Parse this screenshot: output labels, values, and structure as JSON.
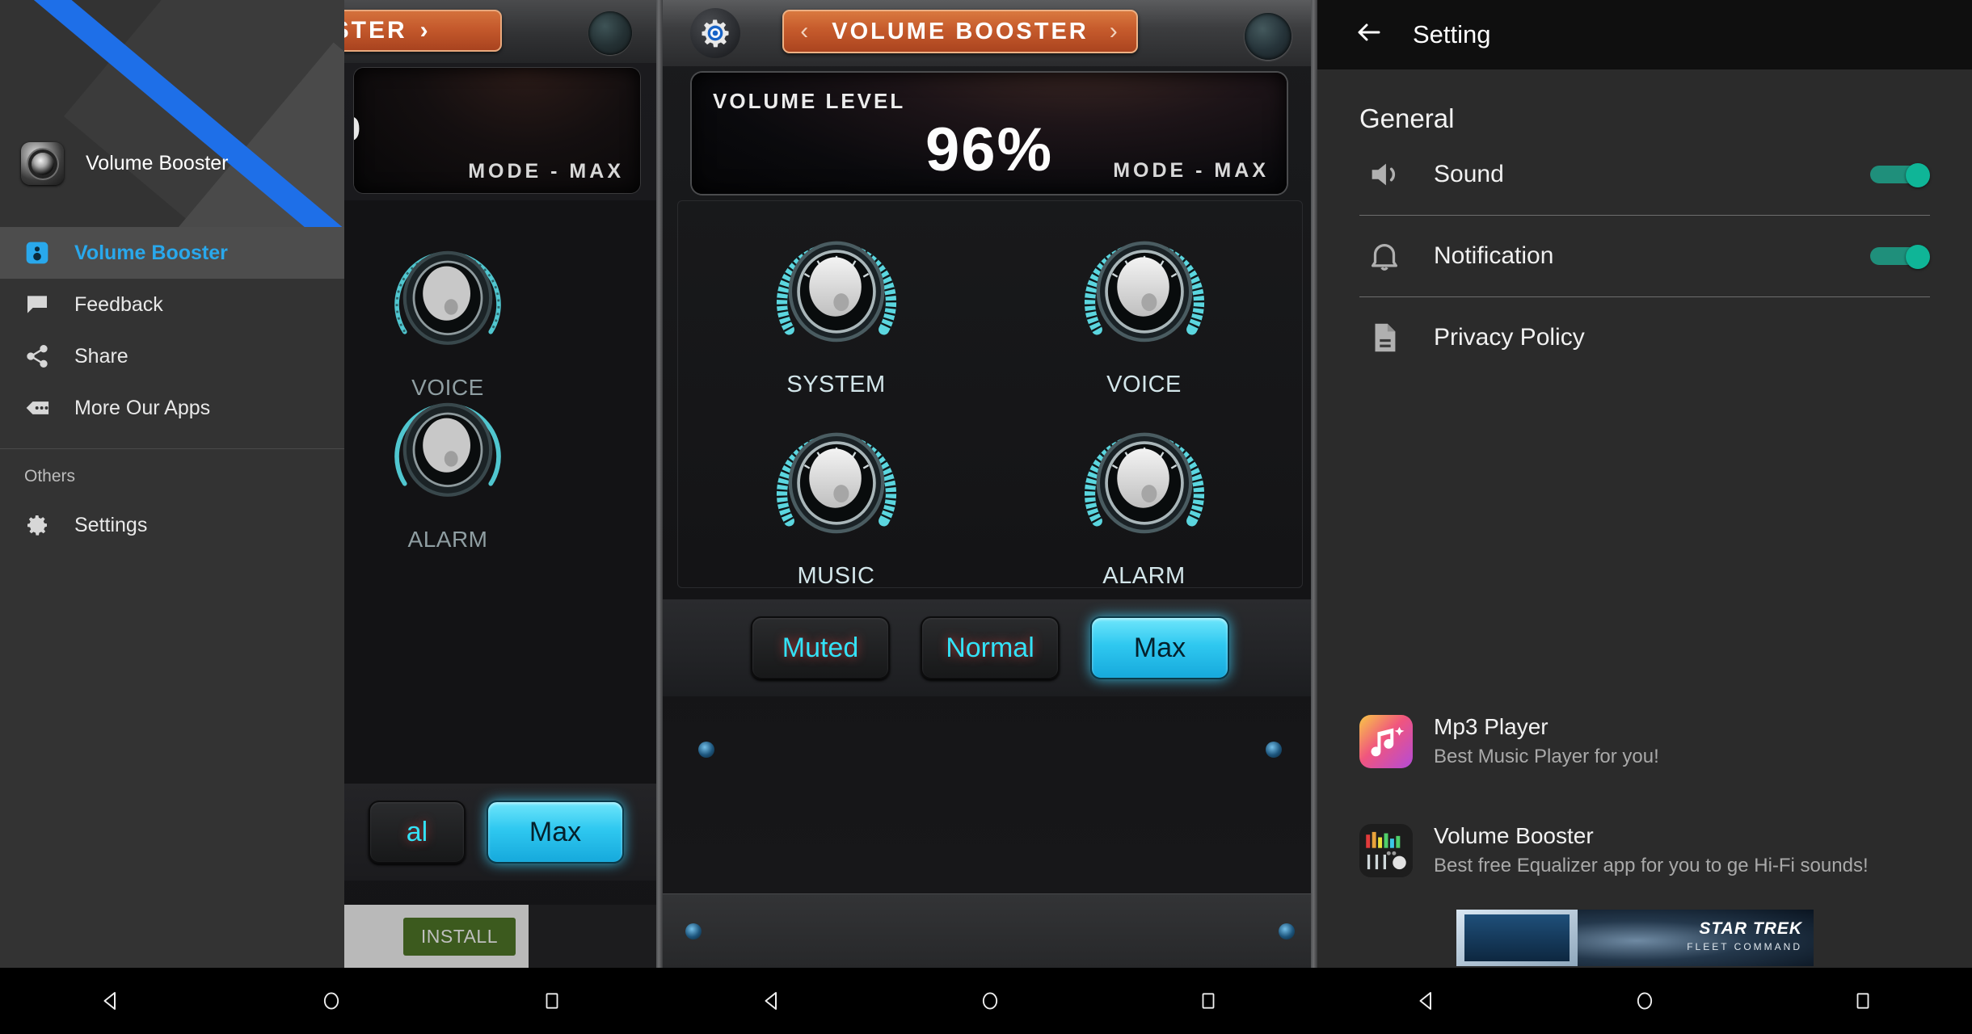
{
  "panel1": {
    "drawer": {
      "app_name": "Volume Booster",
      "items": [
        {
          "label": "Volume Booster",
          "icon": "speaker-icon",
          "active": true
        },
        {
          "label": "Feedback",
          "icon": "chat-icon",
          "active": false
        },
        {
          "label": "Share",
          "icon": "share-icon",
          "active": false
        },
        {
          "label": "More Our Apps",
          "icon": "more-apps-icon",
          "active": false
        }
      ],
      "section_label": "Others",
      "settings_label": "Settings",
      "settings_icon": "gear-icon"
    },
    "app": {
      "title": "BOOSTER",
      "next_arrow": "›",
      "percent": "%",
      "mode": "MODE - MAX",
      "knob_labels": [
        "VOICE",
        "ALARM"
      ],
      "mode_buttons": [
        "al",
        "Max"
      ],
      "install_label": "INSTALL"
    }
  },
  "panel2": {
    "title": "VOLUME BOOSTER",
    "prev_arrow": "‹",
    "next_arrow": "›",
    "gear_icon": "gear-icon",
    "lcd": {
      "label": "VOLUME LEVEL",
      "value": "96%",
      "mode": "MODE - MAX"
    },
    "knobs": [
      {
        "label": "SYSTEM"
      },
      {
        "label": "VOICE"
      },
      {
        "label": "MUSIC"
      },
      {
        "label": "ALARM"
      }
    ],
    "mode_buttons": [
      {
        "label": "Muted",
        "selected": false
      },
      {
        "label": "Normal",
        "selected": false
      },
      {
        "label": "Max",
        "selected": true
      }
    ]
  },
  "panel3": {
    "back_icon": "back-arrow-icon",
    "title": "Setting",
    "section": "General",
    "rows": [
      {
        "label": "Sound",
        "icon": "volume-icon",
        "toggle": true
      },
      {
        "label": "Notification",
        "icon": "bell-icon",
        "toggle": true
      },
      {
        "label": "Privacy Policy",
        "icon": "document-icon",
        "toggle": null
      }
    ],
    "promos": [
      {
        "title": "Mp3 Player",
        "subtitle": "Best Music Player for you!",
        "icon": "mp3-player-icon"
      },
      {
        "title": "Volume Booster",
        "subtitle": "Best free Equalizer app for you to ge Hi-Fi sounds!",
        "icon": "volume-booster-icon"
      }
    ],
    "banner": {
      "title": "STAR TREK",
      "subtitle": "FLEET COMMAND"
    }
  },
  "navbar": {
    "back": "back-triangle-icon",
    "home": "home-circle-icon",
    "recents": "recents-square-icon"
  },
  "colors": {
    "accent_blue": "#29a8ec",
    "toggle_green": "#0fb597",
    "orange_pill": "#c75c2d",
    "knob_cyan": "#56d6e0",
    "install_green": "#3c5a1e"
  }
}
